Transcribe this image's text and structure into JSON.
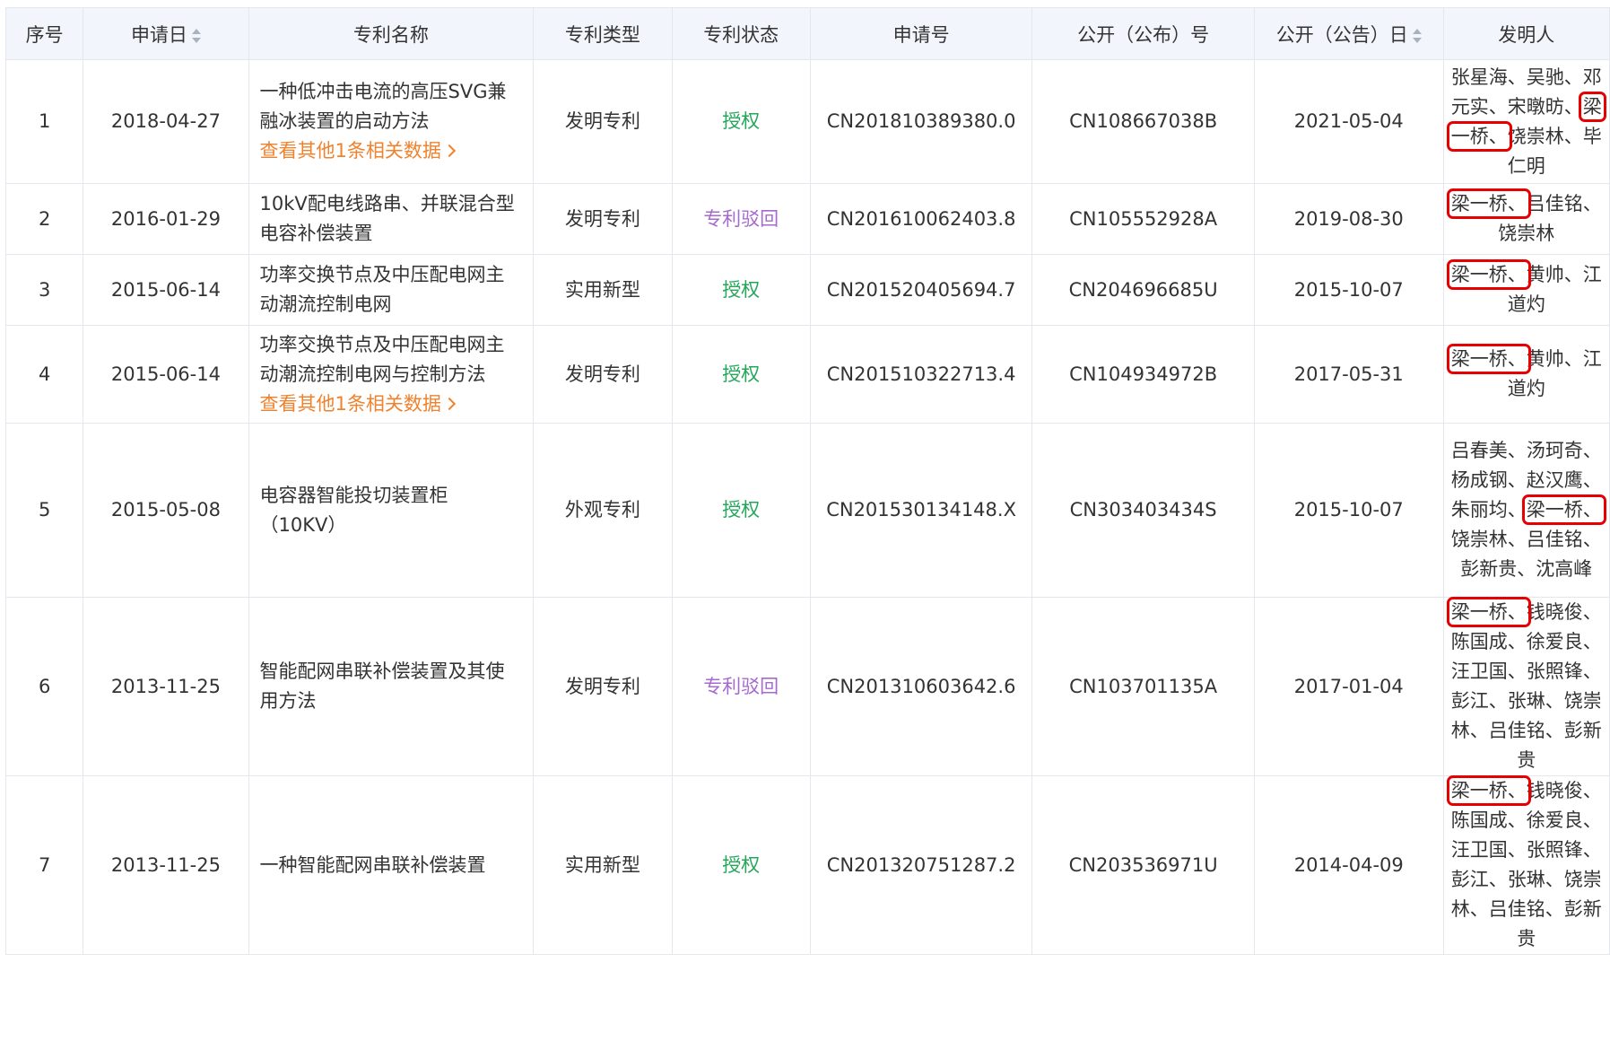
{
  "columns": [
    {
      "label": "序号",
      "sortable": false
    },
    {
      "label": "申请日",
      "sortable": true
    },
    {
      "label": "专利名称",
      "sortable": false
    },
    {
      "label": "专利类型",
      "sortable": false
    },
    {
      "label": "专利状态",
      "sortable": false
    },
    {
      "label": "申请号",
      "sortable": false
    },
    {
      "label": "公开（公布）号",
      "sortable": false
    },
    {
      "label": "公开（公告）日",
      "sortable": true
    },
    {
      "label": "发明人",
      "sortable": false
    }
  ],
  "colors": {
    "granted": "#26a65b",
    "rejected": "#a46ad1",
    "link": "#f0822d",
    "highlight": "#e60000",
    "header_bg": "#f2f6fc",
    "border": "#e4e7ed"
  },
  "highlighted_inventor": "梁一桥",
  "rows": [
    {
      "no": "1",
      "date": "2018-04-27",
      "name": "一种低冲击电流的高压SVG兼融冰装置的启动方法",
      "more": "查看其他1条相关数据",
      "type": "发明专利",
      "status": "授权",
      "status_color": "green",
      "app_no": "CN201810389380.0",
      "pub_no": "CN108667038B",
      "pub_date": "2021-05-04",
      "inv_before": "张星海、吴驰、邓元实、宋暾昉、",
      "inv_hl": "梁一桥、",
      "inv_after": "饶崇林、毕仁明"
    },
    {
      "no": "2",
      "date": "2016-01-29",
      "name": "10kV配电线路串、并联混合型电容补偿装置",
      "more": "",
      "type": "发明专利",
      "status": "专利驳回",
      "status_color": "purple",
      "app_no": "CN201610062403.8",
      "pub_no": "CN105552928A",
      "pub_date": "2019-08-30",
      "inv_before": "",
      "inv_hl": "梁一桥、",
      "inv_after": "吕佳铭、饶崇林"
    },
    {
      "no": "3",
      "date": "2015-06-14",
      "name": "功率交换节点及中压配电网主动潮流控制电网",
      "more": "",
      "type": "实用新型",
      "status": "授权",
      "status_color": "green",
      "app_no": "CN201520405694.7",
      "pub_no": "CN204696685U",
      "pub_date": "2015-10-07",
      "inv_before": "",
      "inv_hl": "梁一桥、",
      "inv_after": "黄帅、江道灼"
    },
    {
      "no": "4",
      "date": "2015-06-14",
      "name": "功率交换节点及中压配电网主动潮流控制电网与控制方法",
      "more": "查看其他1条相关数据",
      "type": "发明专利",
      "status": "授权",
      "status_color": "green",
      "app_no": "CN201510322713.4",
      "pub_no": "CN104934972B",
      "pub_date": "2017-05-31",
      "inv_before": "",
      "inv_hl": "梁一桥、",
      "inv_after": "黄帅、江道灼"
    },
    {
      "no": "5",
      "date": "2015-05-08",
      "name": "电容器智能投切装置柜（10KV）",
      "more": "",
      "type": "外观专利",
      "status": "授权",
      "status_color": "green",
      "app_no": "CN201530134148.X",
      "pub_no": "CN303403434S",
      "pub_date": "2015-10-07",
      "inv_before": "吕春美、汤珂奇、杨成钢、赵汉鹰、朱丽均、",
      "inv_hl": "梁一桥、",
      "inv_after": "饶崇林、吕佳铭、彭新贵、沈高峰"
    },
    {
      "no": "6",
      "date": "2013-11-25",
      "name": "智能配网串联补偿装置及其使用方法",
      "more": "",
      "type": "发明专利",
      "status": "专利驳回",
      "status_color": "purple",
      "app_no": "CN201310603642.6",
      "pub_no": "CN103701135A",
      "pub_date": "2017-01-04",
      "inv_before": "",
      "inv_hl": "梁一桥、",
      "inv_after": "钱晓俊、陈国成、徐爱良、汪卫国、张照锋、彭江、张琳、饶崇林、吕佳铭、彭新贵"
    },
    {
      "no": "7",
      "date": "2013-11-25",
      "name": "一种智能配网串联补偿装置",
      "more": "",
      "type": "实用新型",
      "status": "授权",
      "status_color": "green",
      "app_no": "CN201320751287.2",
      "pub_no": "CN203536971U",
      "pub_date": "2014-04-09",
      "inv_before": "",
      "inv_hl": "梁一桥、",
      "inv_after": "钱晓俊、陈国成、徐爱良、汪卫国、张照锋、彭江、张琳、饶崇林、吕佳铭、彭新贵"
    }
  ]
}
